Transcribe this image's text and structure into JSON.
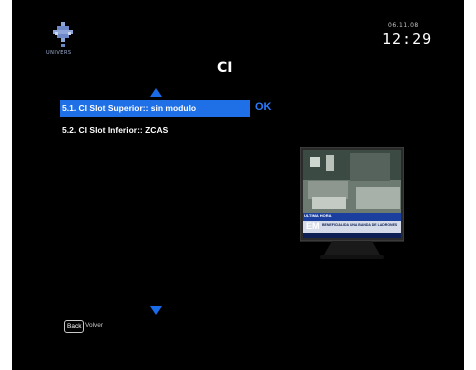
{
  "header": {
    "logo_text": "UNIVERS",
    "date": "06.11.08",
    "time": "12:29"
  },
  "page": {
    "title": "CI"
  },
  "menu": {
    "items": [
      {
        "label": "5.1. CI Slot Superior:: sin modulo",
        "selected": true
      },
      {
        "label": "5.2. CI Slot Inferior:: ZCAS",
        "selected": false
      }
    ],
    "ok_label": "OK"
  },
  "preview": {
    "ticker_text": "BENEFICIALIDA UNA BANDA DE LADRONES",
    "news_tag": "ULTIMA HORA",
    "channel_logo": "EM"
  },
  "footer": {
    "back_key": "Back",
    "back_label": "Volver"
  },
  "colors": {
    "background": "#000000",
    "selection": "#1f6fe6",
    "accent": "#2b7bff"
  }
}
